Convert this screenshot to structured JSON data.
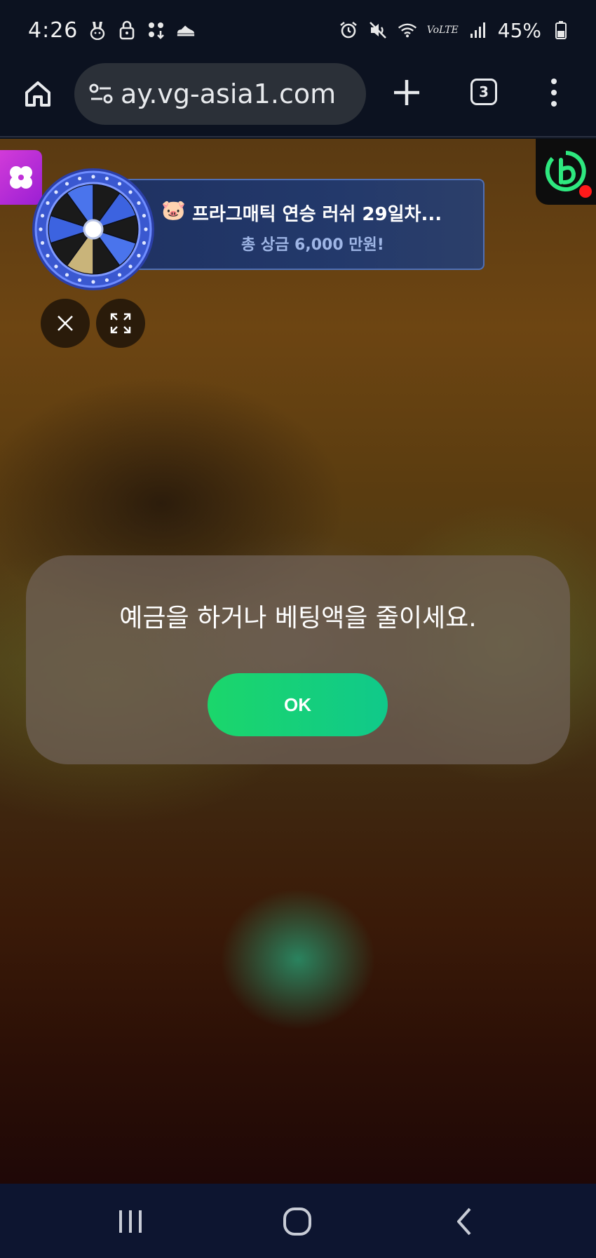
{
  "status_bar": {
    "time": "4:26",
    "battery": "45%",
    "network": "VoLTE",
    "left_icons": [
      "rabbit-icon",
      "lock-icon",
      "apps-icon",
      "shoe-icon"
    ],
    "right_icons": [
      "alarm-icon",
      "mute-icon",
      "wifi-icon",
      "volte-icon",
      "signal-icon",
      "battery-icon"
    ]
  },
  "browser": {
    "url": "ay.vg-asia1.com",
    "tab_count": "3"
  },
  "game": {
    "promo_title": "프라그매틱 연승 러쉬 29일차...",
    "promo_emoji": "🐷",
    "promo_subtitle": "총 상금 6,000 만원!"
  },
  "dialog": {
    "message": "예금을 하거나 베팅액을 줄이세요.",
    "ok_label": "OK"
  },
  "colors": {
    "ok_button": "#10c98a",
    "banner": "#23396b",
    "clover_badge": "#c02fd8",
    "widget_accent": "#2ee87f"
  }
}
